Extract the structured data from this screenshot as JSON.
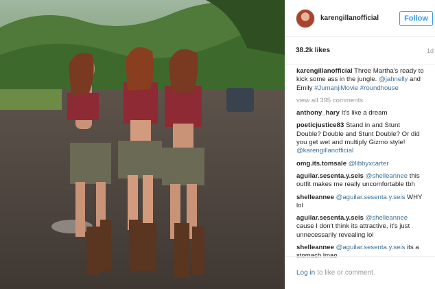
{
  "post": {
    "username": "karengillanofficial",
    "follow_label": "Follow",
    "likes": "38.2k likes",
    "age": "1d"
  },
  "caption": {
    "user": "karengillanofficial",
    "text": "Three Martha's ready to kick some ass in the jungle.",
    "mention1": "@jahnelly",
    "and": "and Emily",
    "tag1": "#JumanjiMovie",
    "tag2": "#roundhouse"
  },
  "view_all": "view all 395 comments",
  "comments": [
    {
      "user": "anthony_hary",
      "parts": [
        {
          "t": "It's like a dream",
          "link": false
        }
      ]
    },
    {
      "user": "poeticjustice83",
      "parts": [
        {
          "t": "Stand in and Stunt Double? Double and Stunt Double? Or did you get wet and multiply Gizmo style!",
          "link": false
        },
        {
          "t": "@karengillanofficial",
          "link": true
        }
      ]
    },
    {
      "user": "omg.its.tomsale",
      "parts": [
        {
          "t": "@libbyxcarter",
          "link": true
        }
      ]
    },
    {
      "user": "aguilar.sesenta.y.seis",
      "parts": [
        {
          "t": "@shelleannee",
          "link": true
        },
        {
          "t": "this outfit makes me really uncomfortable tbh",
          "link": false
        }
      ]
    },
    {
      "user": "shelleannee",
      "parts": [
        {
          "t": "@aguilar.sesenta.y.seis",
          "link": true
        },
        {
          "t": "WHY lol",
          "link": false
        }
      ]
    },
    {
      "user": "aguilar.sesenta.y.seis",
      "parts": [
        {
          "t": "@shelleannee",
          "link": true
        },
        {
          "t": "cause I don't think its attractive, it's just unnecessarily revealing lol",
          "link": false
        }
      ]
    },
    {
      "user": "shelleannee",
      "parts": [
        {
          "t": "@aguilar.sesenta.y.seis",
          "link": true
        },
        {
          "t": "its a stomach lmao",
          "link": false
        }
      ]
    }
  ],
  "footer": {
    "login": "Log in",
    "rest": "to like or comment."
  }
}
